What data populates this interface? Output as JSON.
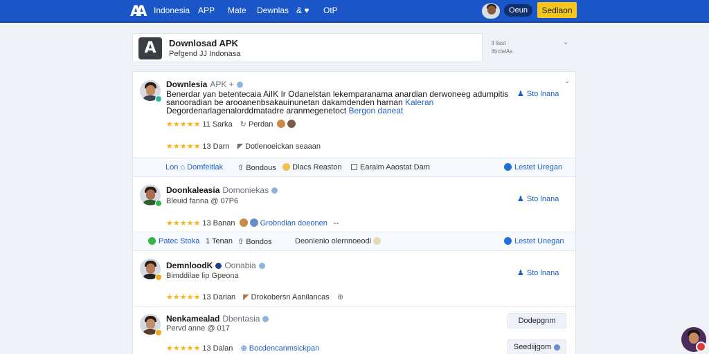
{
  "topbar": {
    "logo_text": "A",
    "nav": [
      "Indonesia",
      "APP",
      "Mate",
      "Dewnlas",
      "& ♥",
      "OtP"
    ],
    "pill_label": "Oeun",
    "button_label": "Sedlaon"
  },
  "header_card": {
    "title": "Downlosad APK",
    "subtitle": "Pefgend JJ Indonasa",
    "side_note_line1": "ll Ilast",
    "side_note_line2": "lftrclelAs",
    "icon_letter": "A"
  },
  "posts": [
    {
      "name": "Downlesia",
      "meta": "APK +",
      "text_line1": "Benerdar yan betentecaia AiIK Ir Odanelstan lekemparanama anardian derwoneeg adumpitis",
      "text_line2_a": "sanooradian be arooanenbsakauinunetan dakamdenden harnan ",
      "text_line2_link": "Kaleran",
      "text_line3": "Degordenarlagenalorddmatadre aranmegenetoct ",
      "text_line3_link": "Bergon daneat",
      "rating_line1": "11 Sarka",
      "rating_line1_b": "Perdan",
      "rating_line2": "13 Darn",
      "rating_line2_b": "Dotlenoeickan seaaan",
      "follow_label": "Sto lnana"
    },
    {
      "name": "Doonkaleasia",
      "meta": "Domoniekas",
      "sub": "Bleuid fanna @ 07P6",
      "rating": "13 Banan",
      "rating_link": "Grobndian doeonen",
      "rating_tail": "--",
      "follow_label": "Sto lnana"
    },
    {
      "name": "DemnloodK",
      "meta": "Oonabia",
      "sub": "Bimddilae lip Gpeona",
      "rating": "13 Darian",
      "rating_b": "Drokobersn Aanilancas",
      "follow_label": "Sto lnana"
    },
    {
      "name": "Nenkamealad",
      "meta": "Dbentasia",
      "sub": "Pervd anne @ 017",
      "rating": "13 Dalan",
      "rating_link": "Bocdencanmsickpan",
      "button_label": "Dodepgnm",
      "button_label_2": "Seediijgom"
    }
  ],
  "action_bars": [
    {
      "left": "Lon",
      "left_b": "Domfeitlak",
      "mid1": "Bondous",
      "mid2": "Dlacs Reaston",
      "mid3": "Earaim Aaostat Dam",
      "right": "Lestet Uregan"
    },
    {
      "left": "Patec Stoka",
      "mid1": "1 Tenan",
      "mid2": "Bondos",
      "mid3": "Deonlenio olernnoeodi",
      "right": "Lestet Unegan"
    }
  ]
}
